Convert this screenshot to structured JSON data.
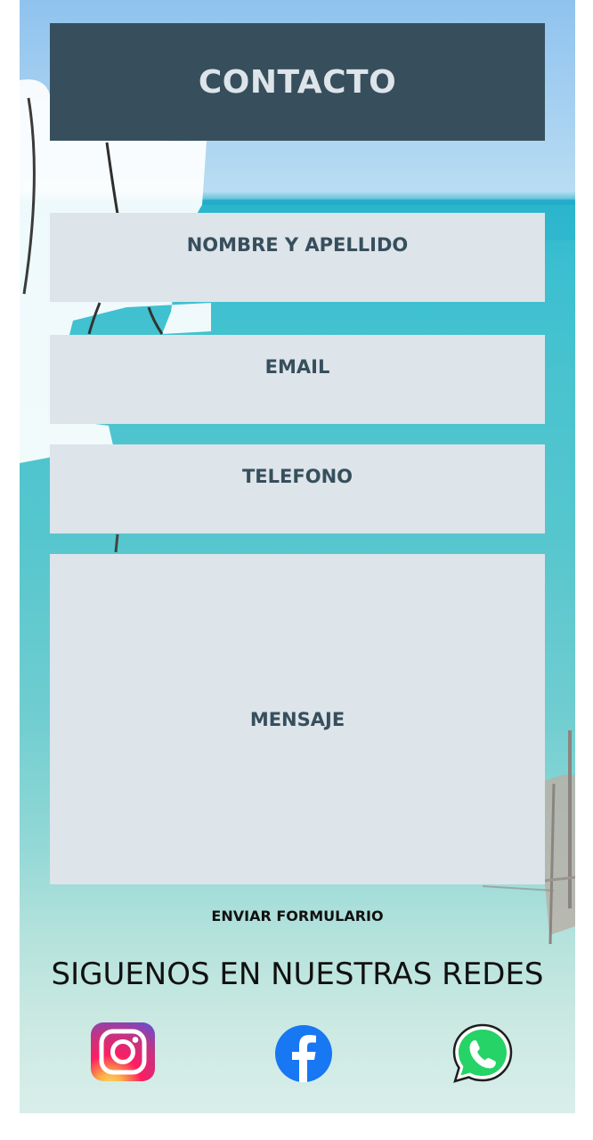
{
  "header": {
    "title": "CONTACTO"
  },
  "form": {
    "name_placeholder": "NOMBRE Y APELLIDO",
    "email_placeholder": "EMAIL",
    "phone_placeholder": "TELEFONO",
    "message_placeholder": "MENSAJE",
    "submit_label": "ENVIAR FORMULARIO"
  },
  "social": {
    "title": "SIGUENOS EN NUESTRAS REDES",
    "links": [
      {
        "icon": "instagram-icon"
      },
      {
        "icon": "facebook-icon"
      },
      {
        "icon": "whatsapp-icon"
      }
    ]
  },
  "colors": {
    "header_bg": "#374f5c",
    "field_bg": "#dde4ea",
    "field_text": "#374f5c",
    "facebook": "#1877f2",
    "whatsapp": "#25d366"
  }
}
